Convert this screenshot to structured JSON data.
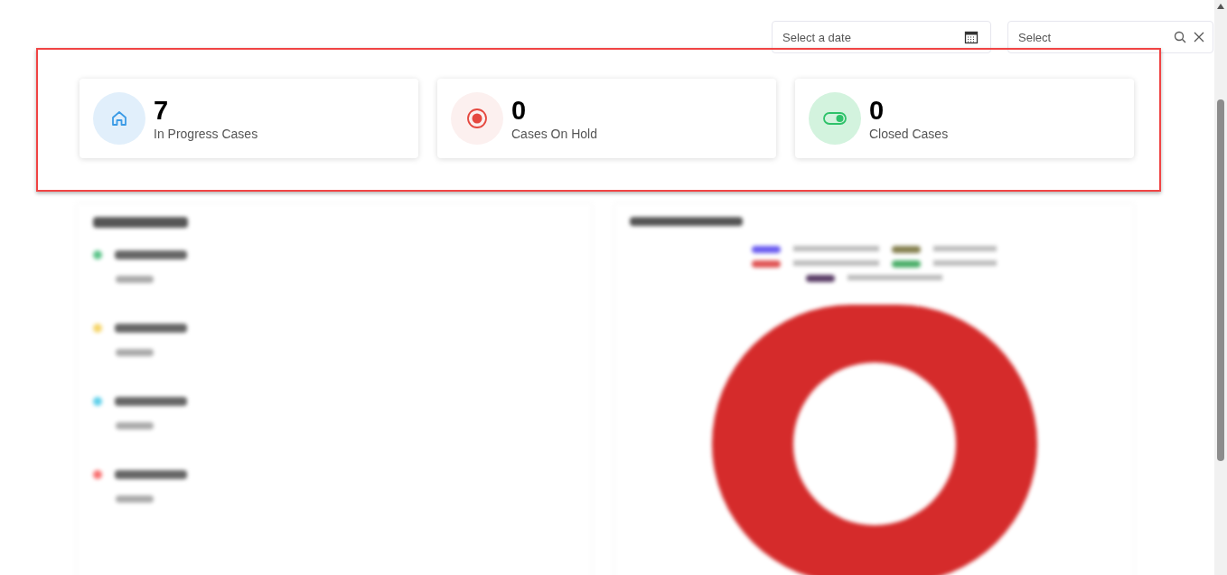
{
  "filters": {
    "date": {
      "placeholder": "Select a date"
    },
    "select": {
      "placeholder": "Select"
    }
  },
  "stats": [
    {
      "kind": "progress",
      "value": "7",
      "label": "In Progress Cases"
    },
    {
      "kind": "hold",
      "value": "0",
      "label": "Cases On Hold"
    },
    {
      "kind": "closed",
      "value": "0",
      "label": "Closed Cases"
    }
  ]
}
